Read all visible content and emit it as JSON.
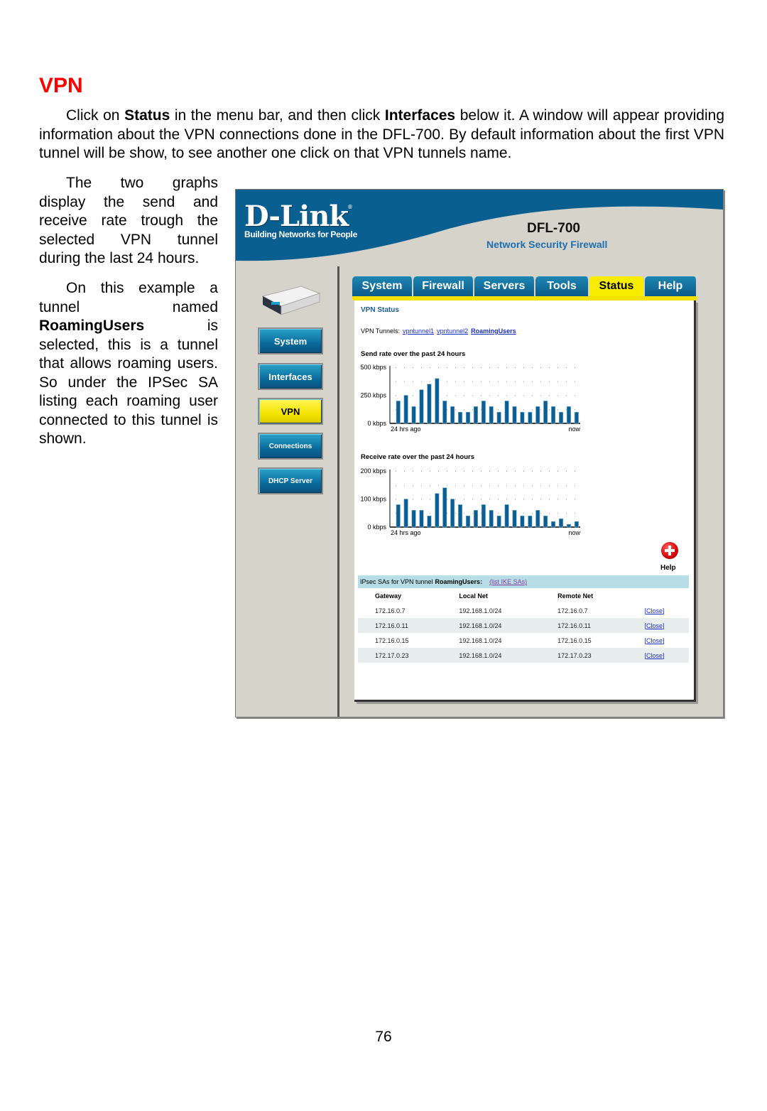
{
  "doc": {
    "title": "VPN",
    "intro": {
      "t1": "Click on ",
      "b1": "Status",
      "t2": " in the menu bar, and then click ",
      "b2": "Interfaces",
      "t3": " below it. A window will appear providing information about the VPN connections done in the DFL-700. By default information about the first VPN tunnel will be show, to see another one click on that VPN tunnels name."
    },
    "side1": "The two graphs display the send and receive rate trough the selected VPN tunnel during the last 24 hours.",
    "side2": {
      "t1": "On this example a tunnel named ",
      "b1": "RoamingUsers",
      "t2": " is selected, this is a tunnel that allows roaming users. So under the IPSec SA listing each roaming user connected to this tunnel is shown."
    },
    "page_number": "76"
  },
  "screenshot": {
    "brand": "D-Link",
    "registered": "®",
    "tagline": "Building Networks for People",
    "model": "DFL-700",
    "product": "Network Security Firewall",
    "sidebar": [
      {
        "label": "System",
        "active": false
      },
      {
        "label": "Interfaces",
        "active": false
      },
      {
        "label": "VPN",
        "active": true
      },
      {
        "label": "Connections",
        "active": false
      },
      {
        "label": "DHCP Server",
        "active": false
      }
    ],
    "tabs": [
      {
        "label": "System",
        "active": false
      },
      {
        "label": "Firewall",
        "active": false
      },
      {
        "label": "Servers",
        "active": false
      },
      {
        "label": "Tools",
        "active": false
      },
      {
        "label": "Status",
        "active": true
      },
      {
        "label": "Help",
        "active": false
      }
    ],
    "section_title": "VPN Status",
    "tunnels_label": "VPN Tunnels:",
    "tunnels": [
      {
        "label": "vpntunnel1",
        "selected": false
      },
      {
        "label": "vpntunnel2",
        "selected": false
      },
      {
        "label": "RoamingUsers",
        "selected": true
      }
    ],
    "help_label": "Help",
    "sa": {
      "prefix": "IPsec SAs for VPN tunnel",
      "tunnel": "RoamingUsers:",
      "link": "(list IKE SAs)",
      "columns": [
        "Gateway",
        "Local Net",
        "Remote Net",
        ""
      ],
      "rows": [
        {
          "gateway": "172.16.0.7",
          "local": "192.168.1.0/24",
          "remote": "172.16.0.7",
          "action": "[Close]"
        },
        {
          "gateway": "172.16.0.11",
          "local": "192.168.1.0/24",
          "remote": "172.16.0.11",
          "action": "[Close]"
        },
        {
          "gateway": "172.16.0.15",
          "local": "192.168.1.0/24",
          "remote": "172.16.0.15",
          "action": "[Close]"
        },
        {
          "gateway": "172.17.0.23",
          "local": "192.168.1.0/24",
          "remote": "172.17.0.23",
          "action": "[Close]"
        }
      ]
    }
  },
  "colors": {
    "title_red": "#ff0000",
    "bar_blue": "#0a5e94",
    "link_blue": "#1c2ec7",
    "tab_yellow": "#f8ec00",
    "banner_blue": "#0a5f91"
  },
  "chart_data": [
    {
      "type": "bar",
      "title": "Send rate over the past 24 hours",
      "ylabel": "",
      "xlabel": "",
      "x_start_label": "24 hrs ago",
      "x_end_label": "now",
      "y_ticks": [
        "0 kbps",
        "250 kbps",
        "500 kbps"
      ],
      "ylim": [
        0,
        500
      ],
      "grid": true,
      "values": [
        200,
        250,
        150,
        300,
        350,
        400,
        200,
        150,
        100,
        100,
        150,
        200,
        150,
        100,
        200,
        150,
        100,
        100,
        150,
        200,
        150,
        100,
        150,
        100
      ]
    },
    {
      "type": "bar",
      "title": "Receive rate over the past 24 hours",
      "ylabel": "",
      "xlabel": "",
      "x_start_label": "24 hrs ago",
      "x_end_label": "now",
      "y_ticks": [
        "0 kbps",
        "100 kbps",
        "200 kbps"
      ],
      "ylim": [
        0,
        200
      ],
      "grid": true,
      "values": [
        80,
        100,
        60,
        60,
        40,
        120,
        140,
        100,
        80,
        40,
        60,
        80,
        60,
        40,
        80,
        60,
        40,
        40,
        60,
        40,
        20,
        30,
        10,
        20
      ]
    }
  ]
}
